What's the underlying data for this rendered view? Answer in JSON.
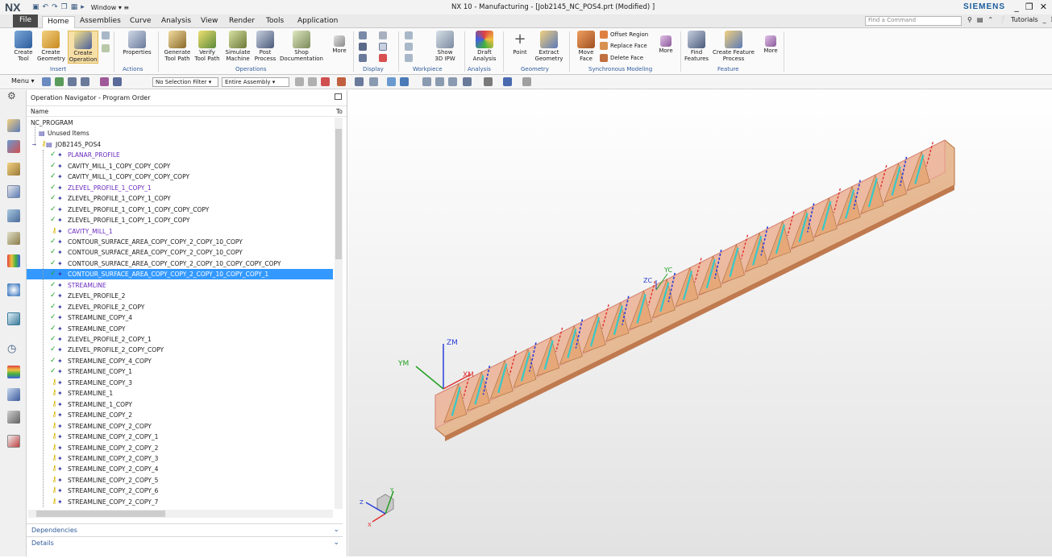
{
  "titlebar": {
    "logo": "NX",
    "window_menu": "Window ▾ ≡",
    "title": "NX 10 - Manufacturing - [Job2145_NC_POS4.prt (Modified) ]",
    "brand": "SIEMENS",
    "controls": [
      "_",
      "❐",
      "✕"
    ]
  },
  "tabs": {
    "file": "File",
    "items": [
      "Home",
      "Assemblies",
      "Curve",
      "Analysis",
      "View",
      "Render",
      "Tools",
      "Application"
    ],
    "find_placeholder": "Find a Command",
    "tutorials": "Tutorials"
  },
  "ribbon": {
    "buttons": {
      "create_tool": "Create\nTool",
      "create_geometry": "Create\nGeometry",
      "create_operation": "Create\nOperation",
      "properties": "Properties",
      "generate_tool_path": "Generate\nTool Path",
      "verify_tool_path": "Verify\nTool Path",
      "simulate_machine": "Simulate\nMachine",
      "post_process": "Post\nProcess",
      "shop_documentation": "Shop\nDocumentation",
      "more1": "More",
      "show_3d_ipw": "Show\n3D IPW",
      "draft_analysis": "Draft\nAnalysis",
      "point": "Point",
      "extract_geometry": "Extract\nGeometry",
      "move_face": "Move\nFace",
      "offset_region": "Offset Region",
      "replace_face": "Replace Face",
      "delete_face": "Delete Face",
      "more2": "More",
      "find_features": "Find\nFeatures",
      "create_feature_process": "Create Feature\nProcess",
      "more3": "More"
    },
    "groups": [
      "Insert",
      "Actions",
      "Operations",
      "Display",
      "Workpiece",
      "Analysis",
      "Geometry",
      "Synchronous Modeling",
      "Feature"
    ]
  },
  "toolbar2": {
    "menu": "Menu ▾",
    "selection_filter": "No Selection Filter",
    "assembly_scope": "Entire Assembly"
  },
  "navigator": {
    "title": "Operation Navigator - Program Order",
    "col_name": "Name",
    "col_tool": "To",
    "program": "NC_PROGRAM",
    "unused": "Unused Items",
    "job": "JOB2145_POS4",
    "operations": [
      {
        "name": "PLANAR_PROFILE",
        "status": "ok",
        "style": "purple"
      },
      {
        "name": "CAVITY_MILL_1_COPY_COPY_COPY",
        "status": "ok",
        "style": "normal"
      },
      {
        "name": "CAVITY_MILL_1_COPY_COPY_COPY_COPY",
        "status": "ok",
        "style": "normal"
      },
      {
        "name": "ZLEVEL_PROFILE_1_COPY_1",
        "status": "ok",
        "style": "purple"
      },
      {
        "name": "ZLEVEL_PROFILE_1_COPY_1_COPY",
        "status": "ok",
        "style": "normal"
      },
      {
        "name": "ZLEVEL_PROFILE_1_COPY_1_COPY_COPY_COPY",
        "status": "ok",
        "style": "normal"
      },
      {
        "name": "ZLEVEL_PROFILE_1_COPY_1_COPY_COPY",
        "status": "ok",
        "style": "normal"
      },
      {
        "name": "CAVITY_MILL_1",
        "status": "key",
        "style": "purple"
      },
      {
        "name": "CONTOUR_SURFACE_AREA_COPY_COPY_2_COPY_10_COPY",
        "status": "ok",
        "style": "normal"
      },
      {
        "name": "CONTOUR_SURFACE_AREA_COPY_COPY_2_COPY_10_COPY",
        "status": "ok",
        "style": "normal"
      },
      {
        "name": "CONTOUR_SURFACE_AREA_COPY_COPY_2_COPY_10_COPY_COPY_COPY",
        "status": "ok",
        "style": "normal"
      },
      {
        "name": "CONTOUR_SURFACE_AREA_COPY_COPY_2_COPY_10_COPY_COPY_1",
        "status": "ok",
        "style": "selected"
      },
      {
        "name": "STREAMLINE",
        "status": "ok",
        "style": "purple"
      },
      {
        "name": "ZLEVEL_PROFILE_2",
        "status": "ok",
        "style": "normal"
      },
      {
        "name": "ZLEVEL_PROFILE_2_COPY",
        "status": "ok",
        "style": "normal"
      },
      {
        "name": "STREAMLINE_COPY_4",
        "status": "ok",
        "style": "normal"
      },
      {
        "name": "STREAMLINE_COPY",
        "status": "ok",
        "style": "normal"
      },
      {
        "name": "ZLEVEL_PROFILE_2_COPY_1",
        "status": "ok",
        "style": "normal"
      },
      {
        "name": "ZLEVEL_PROFILE_2_COPY_COPY",
        "status": "ok",
        "style": "normal"
      },
      {
        "name": "STREAMLINE_COPY_4_COPY",
        "status": "ok",
        "style": "normal"
      },
      {
        "name": "STREAMLINE_COPY_1",
        "status": "ok",
        "style": "normal"
      },
      {
        "name": "STREAMLINE_COPY_3",
        "status": "key",
        "style": "normal"
      },
      {
        "name": "STREAMLINE_1",
        "status": "key",
        "style": "normal"
      },
      {
        "name": "STREAMLINE_1_COPY",
        "status": "key",
        "style": "normal"
      },
      {
        "name": "STREAMLINE_COPY_2",
        "status": "key",
        "style": "normal"
      },
      {
        "name": "STREAMLINE_COPY_2_COPY",
        "status": "key",
        "style": "normal"
      },
      {
        "name": "STREAMLINE_COPY_2_COPY_1",
        "status": "key",
        "style": "normal"
      },
      {
        "name": "STREAMLINE_COPY_2_COPY_2",
        "status": "key",
        "style": "normal"
      },
      {
        "name": "STREAMLINE_COPY_2_COPY_3",
        "status": "key",
        "style": "normal"
      },
      {
        "name": "STREAMLINE_COPY_2_COPY_4",
        "status": "key",
        "style": "normal"
      },
      {
        "name": "STREAMLINE_COPY_2_COPY_5",
        "status": "key",
        "style": "normal"
      },
      {
        "name": "STREAMLINE_COPY_2_COPY_6",
        "status": "key",
        "style": "normal"
      },
      {
        "name": "STREAMLINE_COPY_2_COPY_7",
        "status": "key",
        "style": "normal"
      }
    ],
    "dependencies": "Dependencies",
    "details": "Details"
  },
  "viewport": {
    "axis_labels": {
      "zm": "ZM",
      "ym": "YM",
      "xm": "XM",
      "zc": "ZC",
      "yc": "YC"
    },
    "triad_labels": {
      "z": "Z",
      "y": "Y",
      "x": "X"
    }
  },
  "colors": {
    "ok_check": "#22a022",
    "selection": "#3399ff",
    "purple_text": "#6a2bc0",
    "part_fill": "#e8b48c",
    "toolpath_cyan": "#36c8c8",
    "toolpath_red": "#e03030",
    "toolpath_blue": "#2a3fd8"
  }
}
